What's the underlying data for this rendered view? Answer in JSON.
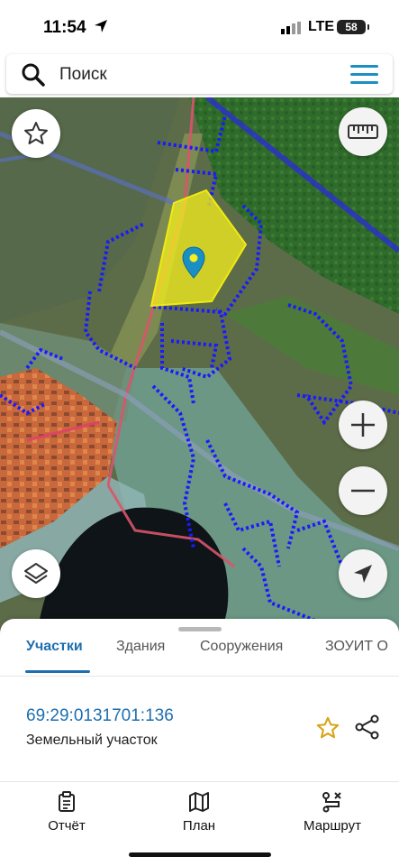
{
  "status": {
    "time": "11:54",
    "network": "LTE",
    "battery": "58"
  },
  "search": {
    "placeholder": "Поиск"
  },
  "map": {
    "buttons": [
      "favorite-star",
      "ruler",
      "zoom-in",
      "zoom-out",
      "layers",
      "locate"
    ],
    "colors": {
      "parcel_fill": "#f5f01e",
      "cadastral_line": "#1a1aff",
      "forest": "#2e6a2a",
      "water": "#0e1417",
      "urban": "#e06a2a"
    }
  },
  "sheet": {
    "tabs": [
      "Участки",
      "Здания",
      "Сооружения",
      "ЗОУИТ О"
    ],
    "active_tab": "Участки",
    "parcel": {
      "number": "69:29:0131701:136",
      "type": "Земельный участок"
    }
  },
  "nav": [
    {
      "label": "Отчёт",
      "icon": "report-icon"
    },
    {
      "label": "План",
      "icon": "map-icon"
    },
    {
      "label": "Маршрут",
      "icon": "route-icon"
    }
  ],
  "accent": "#1d6fb0"
}
